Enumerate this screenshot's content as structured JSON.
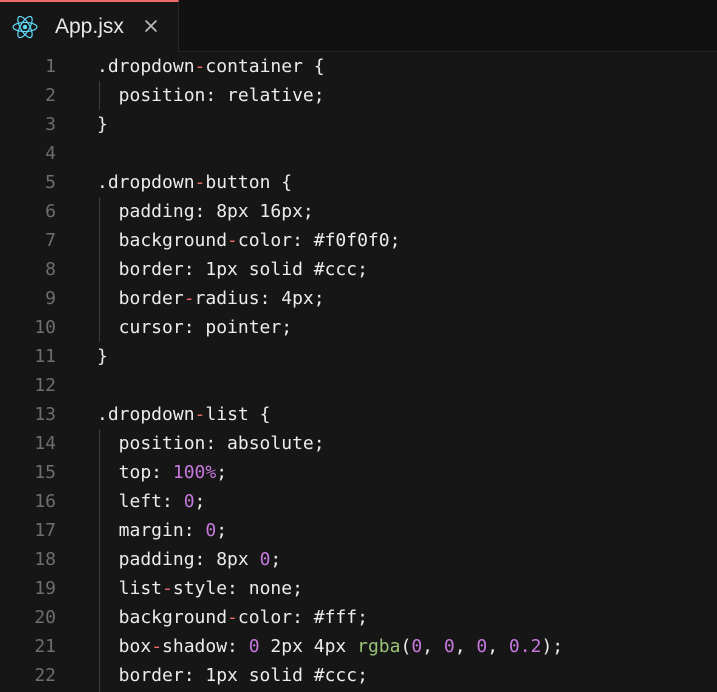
{
  "tab": {
    "icon": "react-icon",
    "filename": "App.jsx",
    "close_icon": "close-icon"
  },
  "colors": {
    "background": "#161616",
    "tabbar": "#111111",
    "active_tab_border": "#ef6b6b",
    "text": "#ececec",
    "line_numbers": "#6e6e6e",
    "operator_dash": "#ef6b6b",
    "number": "#c678dd",
    "function": "#98c379",
    "react_icon": "#61dafb"
  },
  "lines": [
    {
      "n": "1",
      "tokens": [
        {
          "t": ".dropdown",
          "c": "sel"
        },
        {
          "t": "-",
          "c": "dash"
        },
        {
          "t": "container {",
          "c": "sel"
        }
      ]
    },
    {
      "n": "2",
      "tokens": [
        {
          "t": "  position: relative;",
          "c": "sel"
        }
      ]
    },
    {
      "n": "3",
      "tokens": [
        {
          "t": "}",
          "c": "sel"
        }
      ]
    },
    {
      "n": "4",
      "tokens": []
    },
    {
      "n": "5",
      "tokens": [
        {
          "t": ".dropdown",
          "c": "sel"
        },
        {
          "t": "-",
          "c": "dash"
        },
        {
          "t": "button {",
          "c": "sel"
        }
      ]
    },
    {
      "n": "6",
      "tokens": [
        {
          "t": "  padding: 8px 16px;",
          "c": "sel"
        }
      ]
    },
    {
      "n": "7",
      "tokens": [
        {
          "t": "  background",
          "c": "sel"
        },
        {
          "t": "-",
          "c": "dash"
        },
        {
          "t": "color: #f0f0f0;",
          "c": "sel"
        }
      ]
    },
    {
      "n": "8",
      "tokens": [
        {
          "t": "  border: 1px solid #ccc;",
          "c": "sel"
        }
      ]
    },
    {
      "n": "9",
      "tokens": [
        {
          "t": "  border",
          "c": "sel"
        },
        {
          "t": "-",
          "c": "dash"
        },
        {
          "t": "radius: 4px;",
          "c": "sel"
        }
      ]
    },
    {
      "n": "10",
      "tokens": [
        {
          "t": "  cursor: pointer;",
          "c": "sel"
        }
      ]
    },
    {
      "n": "11",
      "tokens": [
        {
          "t": "}",
          "c": "sel"
        }
      ]
    },
    {
      "n": "12",
      "tokens": []
    },
    {
      "n": "13",
      "tokens": [
        {
          "t": ".dropdown",
          "c": "sel"
        },
        {
          "t": "-",
          "c": "dash"
        },
        {
          "t": "list {",
          "c": "sel"
        }
      ]
    },
    {
      "n": "14",
      "tokens": [
        {
          "t": "  position: absolute;",
          "c": "sel"
        }
      ]
    },
    {
      "n": "15",
      "tokens": [
        {
          "t": "  top: ",
          "c": "sel"
        },
        {
          "t": "100%",
          "c": "num"
        },
        {
          "t": ";",
          "c": "sel"
        }
      ]
    },
    {
      "n": "16",
      "tokens": [
        {
          "t": "  left: ",
          "c": "sel"
        },
        {
          "t": "0",
          "c": "num"
        },
        {
          "t": ";",
          "c": "sel"
        }
      ]
    },
    {
      "n": "17",
      "tokens": [
        {
          "t": "  margin: ",
          "c": "sel"
        },
        {
          "t": "0",
          "c": "num"
        },
        {
          "t": ";",
          "c": "sel"
        }
      ]
    },
    {
      "n": "18",
      "tokens": [
        {
          "t": "  padding: 8px ",
          "c": "sel"
        },
        {
          "t": "0",
          "c": "num"
        },
        {
          "t": ";",
          "c": "sel"
        }
      ]
    },
    {
      "n": "19",
      "tokens": [
        {
          "t": "  list",
          "c": "sel"
        },
        {
          "t": "-",
          "c": "dash"
        },
        {
          "t": "style: none;",
          "c": "sel"
        }
      ]
    },
    {
      "n": "20",
      "tokens": [
        {
          "t": "  background",
          "c": "sel"
        },
        {
          "t": "-",
          "c": "dash"
        },
        {
          "t": "color: #fff;",
          "c": "sel"
        }
      ]
    },
    {
      "n": "21",
      "tokens": [
        {
          "t": "  box",
          "c": "sel"
        },
        {
          "t": "-",
          "c": "dash"
        },
        {
          "t": "shadow: ",
          "c": "sel"
        },
        {
          "t": "0",
          "c": "num"
        },
        {
          "t": " 2px 4px ",
          "c": "sel"
        },
        {
          "t": "rgba",
          "c": "fn"
        },
        {
          "t": "(",
          "c": "sel"
        },
        {
          "t": "0",
          "c": "num"
        },
        {
          "t": ", ",
          "c": "sel"
        },
        {
          "t": "0",
          "c": "num"
        },
        {
          "t": ", ",
          "c": "sel"
        },
        {
          "t": "0",
          "c": "num"
        },
        {
          "t": ", ",
          "c": "sel"
        },
        {
          "t": "0.2",
          "c": "num"
        },
        {
          "t": ");",
          "c": "sel"
        }
      ]
    },
    {
      "n": "22",
      "tokens": [
        {
          "t": "  border: 1px solid #ccc;",
          "c": "sel"
        }
      ]
    }
  ]
}
